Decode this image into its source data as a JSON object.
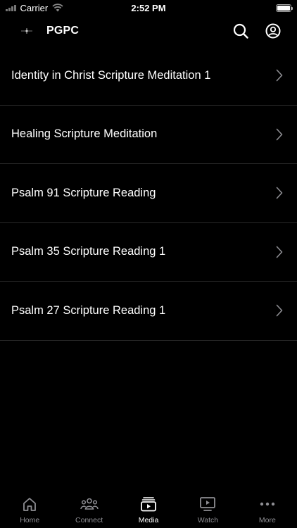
{
  "status_bar": {
    "carrier": "Carrier",
    "time": "2:52 PM"
  },
  "header": {
    "title": "PGPC",
    "logo_icon": "church-logo-icon",
    "actions": [
      "search-icon",
      "account-icon"
    ]
  },
  "media": {
    "items": [
      {
        "title": "Identity in Christ Scripture Meditation 1"
      },
      {
        "title": "Healing Scripture Meditation"
      },
      {
        "title": "Psalm 91 Scripture Reading"
      },
      {
        "title": "Psalm 35 Scripture Reading 1"
      },
      {
        "title": "Psalm 27 Scripture Reading 1"
      }
    ]
  },
  "tabs": [
    {
      "label": "Home",
      "icon": "home-icon"
    },
    {
      "label": "Connect",
      "icon": "people-icon"
    },
    {
      "label": "Media",
      "icon": "media-icon",
      "active": true
    },
    {
      "label": "Watch",
      "icon": "watch-icon"
    },
    {
      "label": "More",
      "icon": "more-icon"
    }
  ],
  "colors": {
    "background": "#000000",
    "text": "#ffffff",
    "inactive": "#8e8e93",
    "divider": "#2a2a2a"
  }
}
